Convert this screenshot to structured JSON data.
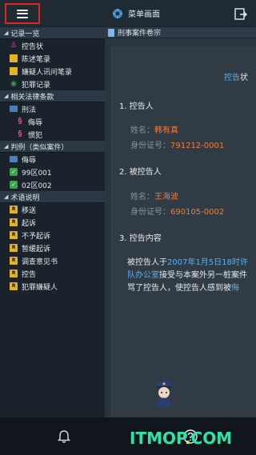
{
  "header": {
    "home_label": "菜单画面",
    "menu_icon": "hamburger-menu-icon",
    "share_icon": "share-export-icon"
  },
  "sidebar": {
    "sections": [
      {
        "title": "记录一览",
        "items": [
          {
            "label": "控告状",
            "icon": "person-icon"
          },
          {
            "label": "陈述笔录",
            "icon": "document-icon"
          },
          {
            "label": "嫌疑人讯问笔录",
            "icon": "document-icon"
          },
          {
            "label": "犯罪记录",
            "icon": "record-icon"
          }
        ]
      },
      {
        "title": "相关法律条款",
        "items": [
          {
            "label": "刑法",
            "icon": "folder-icon"
          },
          {
            "label": "侮辱",
            "icon": "law-icon"
          },
          {
            "label": "惯犯",
            "icon": "law-icon"
          }
        ]
      },
      {
        "title": "判例（类似案件）",
        "items": [
          {
            "label": "侮辱",
            "icon": "folder-icon"
          },
          {
            "label": "99区001",
            "icon": "check-icon"
          },
          {
            "label": "02区002",
            "icon": "check-icon"
          }
        ]
      },
      {
        "title": "术语说明",
        "items": [
          {
            "label": "移送",
            "icon": "term-icon"
          },
          {
            "label": "起诉",
            "icon": "term-icon"
          },
          {
            "label": "不予起诉",
            "icon": "term-icon"
          },
          {
            "label": "暂缓起诉",
            "icon": "term-icon"
          },
          {
            "label": "调查意见书",
            "icon": "term-icon"
          },
          {
            "label": "控告",
            "icon": "term-icon"
          },
          {
            "label": "犯罪嫌疑人",
            "icon": "term-icon"
          }
        ]
      }
    ]
  },
  "content": {
    "tab_label": "刑事案件卷宗",
    "doc_title_hl": "控告",
    "doc_title_rest": "状",
    "s1": "1. 控告人",
    "s1_name_k": "姓名：",
    "s1_name_v": "韩有真",
    "s1_id_k": "身份证号：",
    "s1_id_v": "791212-0001",
    "s2": "2. 被控告人",
    "s2_name_k": "姓名：",
    "s2_name_v": "王海波",
    "s2_id_k": "身份证号：",
    "s2_id_v": "690105-0002",
    "s3": "3. 控告内容",
    "p_a": "被控告人于",
    "p_b": "2007年1月5日18时许",
    "p_c": "队办公室",
    "p_d": "接受与本案外另一桩案件",
    "p_e": "骂了控告人，使控告人感到被",
    "p_f": "侮"
  },
  "footer": {
    "bell_icon": "bell-icon",
    "help_icon": "help-icon"
  },
  "watermark": {
    "text_a": "ITMOP",
    "text_b": ".",
    "text_c": "COM"
  }
}
